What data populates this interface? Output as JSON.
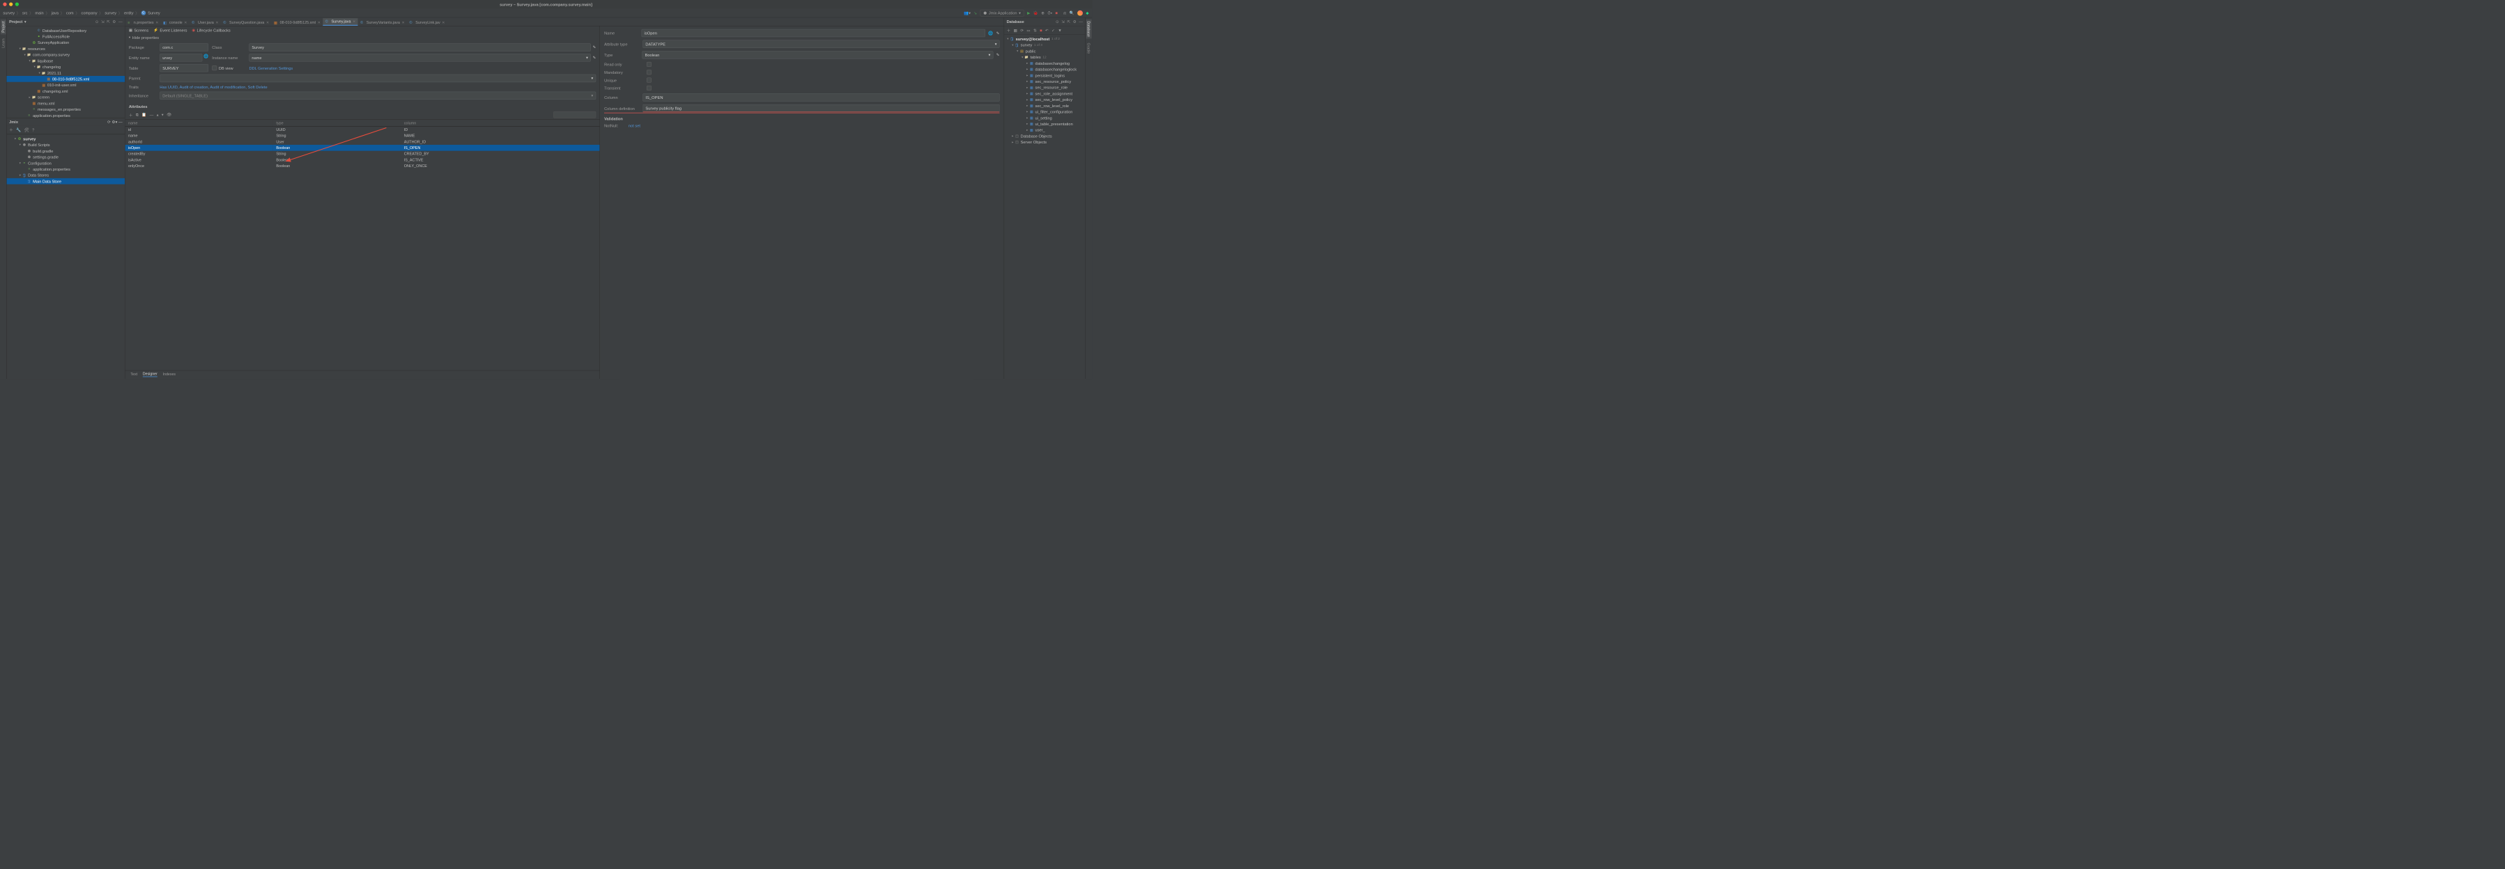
{
  "window_title": "survey – Survey.java [com.company.survey.main]",
  "breadcrumbs": [
    "survey",
    "src",
    "main",
    "java",
    "com",
    "company",
    "survey",
    "entity",
    "Survey"
  ],
  "run_config": "Jmix Application",
  "left_edge_tabs": [
    "Project",
    "Learn"
  ],
  "right_edge_tabs": [
    "Database",
    "Gradle"
  ],
  "project_panel": {
    "title": "Project",
    "tree": [
      {
        "d": 5,
        "ic": "java",
        "label": "DatabaseUserRepository"
      },
      {
        "d": 5,
        "ic": "role",
        "label": "FullAccessRole"
      },
      {
        "d": 4,
        "ic": "spring",
        "label": "SurveyApplication"
      },
      {
        "d": 2,
        "tw": "▾",
        "ic": "folder",
        "label": "resources"
      },
      {
        "d": 3,
        "tw": "▾",
        "ic": "folder",
        "label": "com.company.survey"
      },
      {
        "d": 4,
        "tw": "▾",
        "ic": "folder",
        "label": "liquibase"
      },
      {
        "d": 5,
        "tw": "▾",
        "ic": "folder",
        "label": "changelog"
      },
      {
        "d": 6,
        "tw": "▾",
        "ic": "folder",
        "label": "2021.11"
      },
      {
        "d": 7,
        "ic": "xml",
        "label": "08-010-9d8f5125.xml",
        "sel": true
      },
      {
        "d": 6,
        "ic": "xml",
        "label": "010-init-user.xml"
      },
      {
        "d": 5,
        "ic": "xml2",
        "label": "changelog.xml"
      },
      {
        "d": 4,
        "tw": "▸",
        "ic": "folder",
        "label": "screen"
      },
      {
        "d": 4,
        "ic": "xml2",
        "label": "menu.xml"
      },
      {
        "d": 4,
        "ic": "props",
        "label": "messages_en.properties"
      },
      {
        "d": 3,
        "ic": "props",
        "label": "application.properties"
      },
      {
        "d": 2,
        "tw": "▸",
        "ic": "folder",
        "label": "test"
      }
    ]
  },
  "jmix_panel": {
    "title": "Jmix",
    "tree": [
      {
        "d": 0,
        "tw": "▾",
        "ic": "spring",
        "label": "survey",
        "bold": true
      },
      {
        "d": 1,
        "tw": "▾",
        "ic": "gradle",
        "label": "Build Scripts"
      },
      {
        "d": 2,
        "ic": "gradle",
        "label": "build.gradle"
      },
      {
        "d": 2,
        "ic": "gradle",
        "label": "settings.gradle"
      },
      {
        "d": 1,
        "tw": "▾",
        "ic": "props",
        "label": "Configuration"
      },
      {
        "d": 2,
        "ic": "props",
        "label": "application.properties"
      },
      {
        "d": 1,
        "tw": "▾",
        "ic": "db",
        "label": "Data Stores"
      },
      {
        "d": 2,
        "ic": "db",
        "label": "Main Data Store",
        "sel": true
      }
    ]
  },
  "editor_tabs": [
    {
      "ic": "props",
      "label": "n.properties"
    },
    {
      "ic": "cons",
      "label": "console"
    },
    {
      "ic": "java",
      "label": "User.java"
    },
    {
      "ic": "java",
      "label": "SurveyQuestion.java"
    },
    {
      "ic": "xml",
      "label": "08-010-9d8f5125.xml"
    },
    {
      "ic": "java",
      "label": "Survey.java",
      "act": true
    },
    {
      "ic": "java",
      "label": "SurveyVariants.java"
    },
    {
      "ic": "java",
      "label": "SurveyLink.jav"
    }
  ],
  "subtoolbar": {
    "screens": "Screens",
    "listeners": "Event Listeners",
    "lifecycle": "Lifecycle Callbacks"
  },
  "hide_props": "Hide properties",
  "entity_form": {
    "package_lbl": "Package",
    "package_val": "com.c",
    "class_lbl": "Class",
    "class_val": "Survey",
    "entity_lbl": "Entity name",
    "entity_val": "urvey",
    "instance_lbl": "Instance name",
    "instance_val": "name",
    "table_lbl": "Table",
    "table_val": "SURVEY",
    "dbview": "DB view",
    "ddl": "DDL Generation Settings",
    "parent_lbl": "Parent",
    "traits_lbl": "Traits",
    "traits_val": "Has UUID, Audit of creation, Audit of modification, Soft Delete",
    "inh_lbl": "Inheritance",
    "inh_val": "Default (SINGLE_TABLE)"
  },
  "attributes_label": "Attributes",
  "attr_search_placeholder": "",
  "attr_cols": {
    "name": "name",
    "type": "type",
    "column": "column"
  },
  "attr_rows": [
    {
      "name": "id",
      "type": "UUID",
      "column": "ID"
    },
    {
      "name": "name",
      "type": "String",
      "column": "NAME"
    },
    {
      "name": "authorId",
      "type": "User",
      "column": "AUTHOR_ID"
    },
    {
      "name": "isOpen",
      "type": "Boolean",
      "column": "IS_OPEN",
      "sel": true
    },
    {
      "name": "createdBy",
      "type": "String",
      "column": "CREATED_BY"
    },
    {
      "name": "isActive",
      "type": "Boolean",
      "column": "IS_ACTIVE"
    },
    {
      "name": "onlyOnce",
      "type": "Boolean",
      "column": "ONLY_ONCE"
    }
  ],
  "bottom_tabs": {
    "text": "Text",
    "designer": "Designer",
    "indexes": "Indexes"
  },
  "attr_props": {
    "name_lbl": "Name",
    "name_val": "isOpen",
    "atype_lbl": "Attribute type",
    "atype_val": "DATATYPE",
    "type_lbl": "Type",
    "type_val": "Boolean",
    "readonly": "Read only",
    "mandatory": "Mandatory",
    "unique": "Unique",
    "transient": "Transient",
    "column_lbl": "Column",
    "column_val": "IS_OPEN",
    "coldef_lbl": "Column definition",
    "coldef_val": "Survey publicity flag",
    "validation": "Validation",
    "notnull_lbl": "NotNull:",
    "notnull_val": "not set"
  },
  "db_panel": {
    "title": "Database",
    "root": "survey@localhost",
    "root_cnt": "1 of 2",
    "items": [
      {
        "d": 1,
        "tw": "▾",
        "ic": "dbroot",
        "label": "survey",
        "cnt": "1 of 3"
      },
      {
        "d": 2,
        "tw": "▾",
        "ic": "schema",
        "label": "public"
      },
      {
        "d": 3,
        "tw": "▾",
        "ic": "folder",
        "label": "tables",
        "cnt": "12"
      },
      {
        "d": 4,
        "tw": "▸",
        "ic": "table",
        "label": "databasechangelog"
      },
      {
        "d": 4,
        "tw": "▸",
        "ic": "table",
        "label": "databasechangeloglock"
      },
      {
        "d": 4,
        "tw": "▸",
        "ic": "table",
        "label": "persistent_logins"
      },
      {
        "d": 4,
        "tw": "▸",
        "ic": "table",
        "label": "sec_resource_policy"
      },
      {
        "d": 4,
        "tw": "▸",
        "ic": "table",
        "label": "sec_resource_role"
      },
      {
        "d": 4,
        "tw": "▸",
        "ic": "table",
        "label": "sec_role_assignment"
      },
      {
        "d": 4,
        "tw": "▸",
        "ic": "table",
        "label": "sec_row_level_policy"
      },
      {
        "d": 4,
        "tw": "▸",
        "ic": "table",
        "label": "sec_row_level_role"
      },
      {
        "d": 4,
        "tw": "▸",
        "ic": "table",
        "label": "ui_filter_configuration"
      },
      {
        "d": 4,
        "tw": "▸",
        "ic": "table",
        "label": "ui_setting"
      },
      {
        "d": 4,
        "tw": "▸",
        "ic": "table",
        "label": "ui_table_presentation"
      },
      {
        "d": 4,
        "tw": "▸",
        "ic": "table",
        "label": "user_"
      },
      {
        "d": 1,
        "tw": "▸",
        "ic": "sobj",
        "label": "Database Objects"
      },
      {
        "d": 1,
        "tw": "▸",
        "ic": "sobj",
        "label": "Server Objects"
      }
    ]
  }
}
